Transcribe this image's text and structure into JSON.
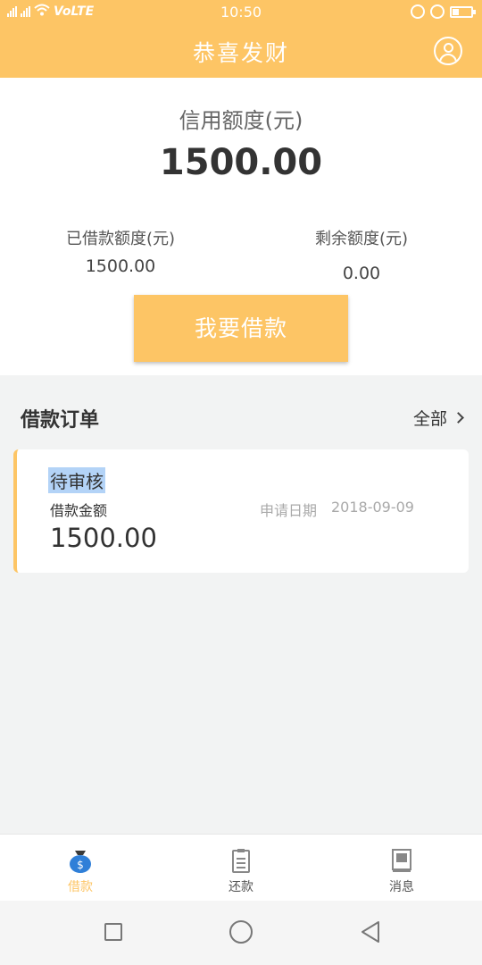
{
  "status_bar": {
    "network": "VoLTE",
    "time": "10:50"
  },
  "header": {
    "title": "恭喜发财"
  },
  "credit": {
    "label": "信用额度(元)",
    "amount": "1500.00",
    "borrowed_label": "已借款额度(元)",
    "borrowed_value": "1500.00",
    "remaining_label": "剩余额度(元)",
    "remaining_value": "0.00",
    "borrow_button": "我要借款"
  },
  "orders": {
    "title": "借款订单",
    "all_label": "全部",
    "items": [
      {
        "status": "待审核",
        "amount_label": "借款金额",
        "amount": "1500.00",
        "date_label": "申请日期",
        "date": "2018-09-09"
      }
    ]
  },
  "tabs": [
    {
      "label": "借款",
      "icon": "money-bag-icon",
      "active": true
    },
    {
      "label": "还款",
      "icon": "clipboard-icon",
      "active": false
    },
    {
      "label": "消息",
      "icon": "message-icon",
      "active": false
    }
  ],
  "colors": {
    "accent": "#fdc565",
    "background": "#f2f3f3",
    "highlight": "#b3d3f7"
  }
}
